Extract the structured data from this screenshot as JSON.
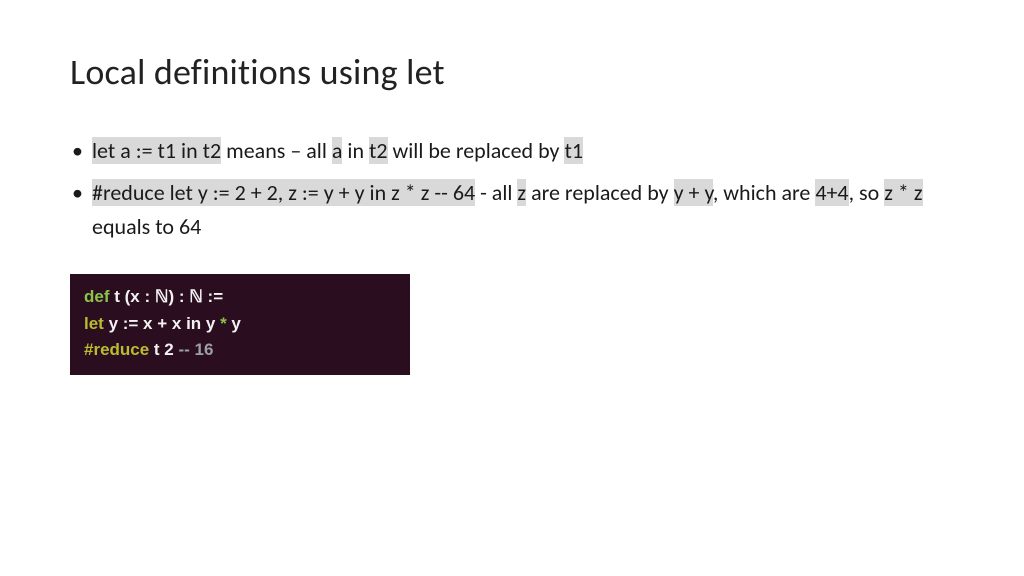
{
  "title": "Local definitions using let",
  "bullet1": {
    "p1": "let a := t1 in t2",
    "p2": " means – all ",
    "p3": "a",
    "p4": " in ",
    "p5": "t2",
    "p6": " will be replaced by ",
    "p7": "t1"
  },
  "bullet2": {
    "p1": "#reduce  let y := 2 + 2, z := y + y in z * z   -- 64",
    "p2": " - all ",
    "p3": "z",
    "p4": " are replaced by ",
    "p5": "y + y",
    "p6": ", which are ",
    "p7": "4+4",
    "p8": ", so ",
    "p9": "z * z",
    "p10": " equals to 64"
  },
  "code": {
    "l1": {
      "kw": "def",
      "rest": " t (x : ℕ) : ℕ :="
    },
    "l2": {
      "kw": "let",
      "r1": " y := x + x in y ",
      "star": "*",
      "r2": " y"
    },
    "l3": {
      "kw": "#reduce",
      "r1": " t 2   ",
      "cmt": "-- 16"
    }
  }
}
